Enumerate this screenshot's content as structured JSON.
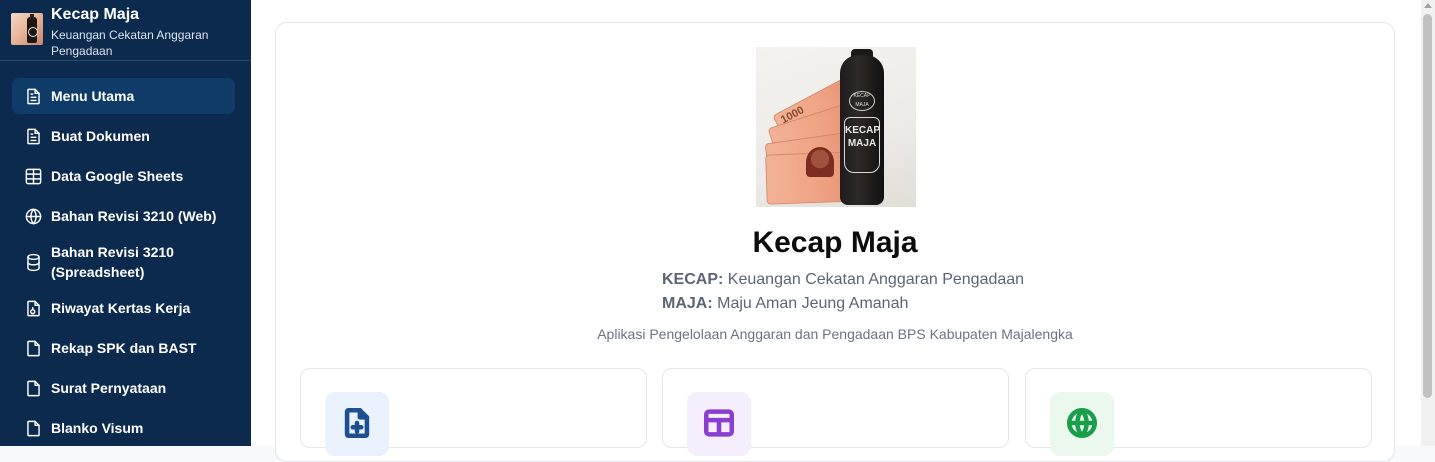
{
  "app": {
    "title": "Kecap Maja",
    "subtitle": "Keuangan Cekatan Anggaran Pengadaan"
  },
  "sidebar": {
    "items": [
      {
        "label": "Menu Utama",
        "icon": "document-icon",
        "active": true
      },
      {
        "label": "Buat Dokumen",
        "icon": "document-icon"
      },
      {
        "label": "Data Google Sheets",
        "icon": "table-icon"
      },
      {
        "label": "Bahan Revisi 3210 (Web)",
        "icon": "globe-icon"
      },
      {
        "label": "Bahan Revisi 3210 (Spreadsheet)",
        "icon": "database-icon"
      },
      {
        "label": "Riwayat Kertas Kerja",
        "icon": "file-history-icon"
      },
      {
        "label": "Rekap SPK dan BAST",
        "icon": "file-icon"
      },
      {
        "label": "Surat Pernyataan",
        "icon": "file-icon"
      },
      {
        "label": "Blanko Visum",
        "icon": "file-icon"
      }
    ]
  },
  "hero": {
    "title": "Kecap Maja",
    "acronym1_key": "KECAP:",
    "acronym1_value": "Keuangan Cekatan Anggaran Pengadaan",
    "acronym2_key": "MAJA:",
    "acronym2_value": "Maju Aman Jeung Amanah",
    "tagline": "Aplikasi Pengelolaan Anggaran dan Pengadaan BPS Kabupaten Majalengka",
    "image": {
      "bill_label": "1000",
      "bottle_label_1": "KECAP",
      "bottle_label_2": "MAJA"
    }
  },
  "features": [
    {
      "icon": "file-plus-icon",
      "color": "#1e4f91",
      "bg": "#eaf2fd"
    },
    {
      "icon": "layout-icon",
      "color": "#8b3fcf",
      "bg": "#f5eefc"
    },
    {
      "icon": "globe-icon",
      "color": "#1a9e4b",
      "bg": "#eaf8ee"
    }
  ],
  "colors": {
    "sidebar_bg": "#0b2a4e",
    "sidebar_active": "#0f3b68"
  }
}
